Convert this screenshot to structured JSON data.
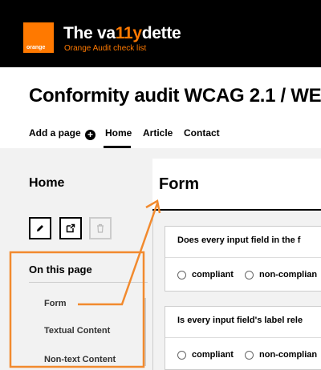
{
  "header": {
    "logo_text": "orange",
    "app_title_prefix": "The va",
    "app_title_accent": "11y",
    "app_title_suffix": "dette",
    "app_subtitle": "Orange Audit check list"
  },
  "page": {
    "title": "Conformity audit WCAG 2.1 / WE"
  },
  "nav": {
    "add_page": "Add a page",
    "items": [
      "Home",
      "Article",
      "Contact"
    ],
    "active": "Home"
  },
  "sidebar": {
    "title": "Home",
    "toc_title": "On this page",
    "toc_items": [
      "Form",
      "Textual Content",
      "Non-text Content"
    ]
  },
  "main": {
    "section_title": "Form",
    "questions": [
      {
        "text": "Does every input field in the f",
        "options": [
          "compliant",
          "non-complian"
        ]
      },
      {
        "text": "Is every input field's label rele",
        "options": [
          "compliant",
          "non-complian"
        ]
      }
    ]
  },
  "colors": {
    "accent": "#ff7900",
    "header_bg": "#000000",
    "annotation": "#f28a2e"
  }
}
